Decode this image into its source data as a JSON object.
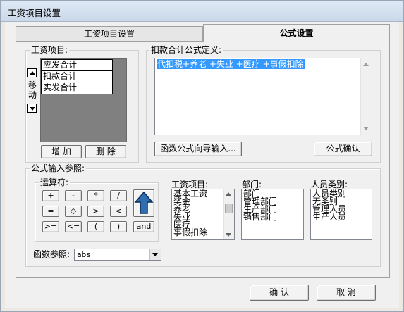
{
  "window": {
    "title": "工资项目设置"
  },
  "tabs": [
    {
      "label": "工资项目设置"
    },
    {
      "label": "公式设置"
    }
  ],
  "salary_items_group": {
    "label": "工资项目:",
    "move_label": "移动",
    "items": [
      "应发合计",
      "扣款合计",
      "实发合计"
    ],
    "add_label": "增 加",
    "delete_label": "删 除"
  },
  "formula_def": {
    "label": "扣款合计公式定义:",
    "value": "代扣税+养老 +失业 +医疗 +事假扣除",
    "wizard_label": "函数公式向导输入...",
    "confirm_label": "公式确认"
  },
  "formula_ref": {
    "label": "公式输入参照:",
    "operators_label": "运算符:",
    "operators": [
      "+",
      "-",
      "*",
      "/",
      "=",
      "◇",
      ">",
      "<",
      ">=",
      "<=",
      "(",
      ")"
    ],
    "and_label": "and",
    "salary_items_label": "工资项目:",
    "salary_items": [
      "基本工资",
      "奖金",
      "养老",
      "失业",
      "医疗",
      "事假扣除"
    ],
    "department_label": "部门:",
    "departments": [
      "部门",
      "管理部门",
      "生产部门",
      "销售部门"
    ],
    "person_type_label": "人员类别:",
    "person_types": [
      "人员类别",
      "无类别",
      "管理人员",
      "生产人员"
    ],
    "func_ref_label": "函数参照:",
    "func_ref_value": "abs"
  },
  "footer": {
    "ok_label": "确 认",
    "cancel_label": "取 消"
  }
}
